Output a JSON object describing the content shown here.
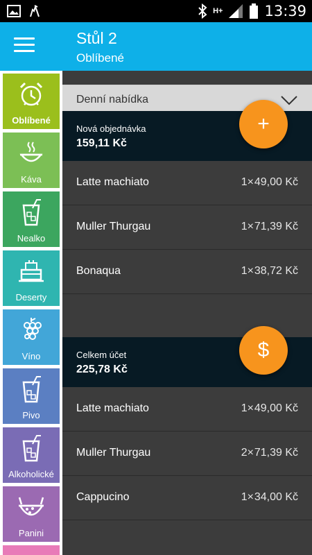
{
  "status_bar": {
    "time": "13:39",
    "network": "H+",
    "icons": [
      "image-icon",
      "android-icon",
      "bluetooth-icon",
      "signal-icon",
      "battery-icon"
    ]
  },
  "app_bar": {
    "title": "Stůl 2",
    "subtitle": "Oblíbené"
  },
  "sidebar": {
    "categories": [
      {
        "label": "Oblíbené",
        "color": "#9bbf1c",
        "icon": "alarm-clock-icon",
        "active": true
      },
      {
        "label": "Káva",
        "color": "#7cbf55",
        "icon": "coffee-bowl-icon",
        "active": false
      },
      {
        "label": "Nealko",
        "color": "#3ca65f",
        "icon": "drink-glass-icon",
        "active": false
      },
      {
        "label": "Deserty",
        "color": "#2fb5b0",
        "icon": "cake-icon",
        "active": false
      },
      {
        "label": "Víno",
        "color": "#42a6d8",
        "icon": "grapes-icon",
        "active": false
      },
      {
        "label": "Pivo",
        "color": "#5b7fc2",
        "icon": "beer-glass-icon",
        "active": false
      },
      {
        "label": "Alkoholické",
        "color": "#7a6cb5",
        "icon": "cocktail-glass-icon",
        "active": false
      },
      {
        "label": "Panini",
        "color": "#9b6ab2",
        "icon": "food-bowl-icon",
        "active": false
      }
    ],
    "peek_color": "#e87bb8"
  },
  "main": {
    "daily_menu": "Denní nabídka",
    "new_order": {
      "label": "Nová objednávka",
      "amount": "159,11 Kč",
      "items": [
        {
          "name": "Latte machiato",
          "qty": "1×",
          "price": "49,00 Kč"
        },
        {
          "name": "Muller Thurgau",
          "qty": "1×",
          "price": "71,39 Kč"
        },
        {
          "name": "Bonaqua",
          "qty": "1×",
          "price": "38,72 Kč"
        }
      ]
    },
    "total": {
      "label": "Celkem účet",
      "amount": "225,78 Kč",
      "items": [
        {
          "name": "Latte machiato",
          "qty": "1×",
          "price": "49,00 Kč"
        },
        {
          "name": "Muller Thurgau",
          "qty": "2×",
          "price": "71,39 Kč"
        },
        {
          "name": "Cappucino",
          "qty": "1×",
          "price": "34,00 Kč"
        }
      ]
    },
    "fab_add": "+",
    "fab_pay": "$",
    "accent": "#f7941d"
  }
}
